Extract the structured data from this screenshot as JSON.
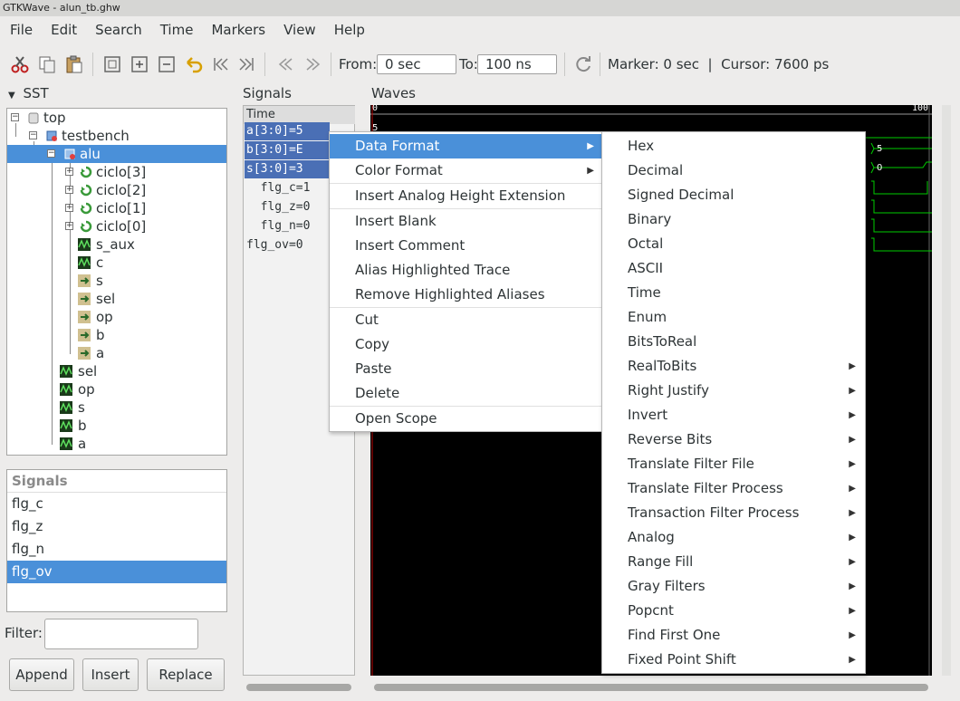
{
  "window": {
    "title": "GTKWave - alun_tb.ghw"
  },
  "menubar": [
    "File",
    "Edit",
    "Search",
    "Time",
    "Markers",
    "View",
    "Help"
  ],
  "toolbar": {
    "from_label": "From:",
    "from_value": "0 sec",
    "to_label": "To:",
    "to_value": "100 ns",
    "marker_text": "Marker: 0 sec  |  Cursor: 7600 ps"
  },
  "sst": {
    "title": "SST",
    "tree": [
      "top",
      "testbench",
      "alu",
      "ciclo[3]",
      "ciclo[2]",
      "ciclo[1]",
      "ciclo[0]",
      "s_aux",
      "c",
      "s",
      "sel",
      "op",
      "b",
      "a",
      "sel",
      "op",
      "s",
      "b",
      "a"
    ]
  },
  "signals_list": {
    "title": "Signals",
    "items": [
      "flg_c",
      "flg_z",
      "flg_n",
      "flg_ov"
    ],
    "filter_label": "Filter:"
  },
  "buttons": {
    "append": "Append",
    "insert": "Insert",
    "replace": "Replace"
  },
  "signals_pane": {
    "title": "Signals",
    "rows": [
      "Time",
      "a[3:0]=5",
      "b[3:0]=E",
      "s[3:0]=3",
      "  flg_c=1",
      "  flg_z=0",
      "  flg_n=0",
      "flg_ov=0"
    ]
  },
  "waves_pane": {
    "title": "Waves",
    "ruler_start": "0",
    "ruler_end": "100",
    "value_labels": [
      "5",
      "5",
      "0"
    ]
  },
  "context_menu": [
    "Data Format",
    "Color Format",
    "Insert Analog Height Extension",
    "Insert Blank",
    "Insert Comment",
    "Alias Highlighted Trace",
    "Remove Highlighted Aliases",
    "Cut",
    "Copy",
    "Paste",
    "Delete",
    "Open Scope"
  ],
  "data_format_submenu": [
    "Hex",
    "Decimal",
    "Signed Decimal",
    "Binary",
    "Octal",
    "ASCII",
    "Time",
    "Enum",
    "BitsToReal",
    "RealToBits",
    "Right Justify",
    "Invert",
    "Reverse Bits",
    "Translate Filter File",
    "Translate Filter Process",
    "Transaction Filter Process",
    "Analog",
    "Range Fill",
    "Gray Filters",
    "Popcnt",
    "Find First One",
    "Fixed Point Shift"
  ],
  "colors": {
    "selection": "#4a90d9",
    "wave": "#00d000",
    "background": "#000000"
  }
}
